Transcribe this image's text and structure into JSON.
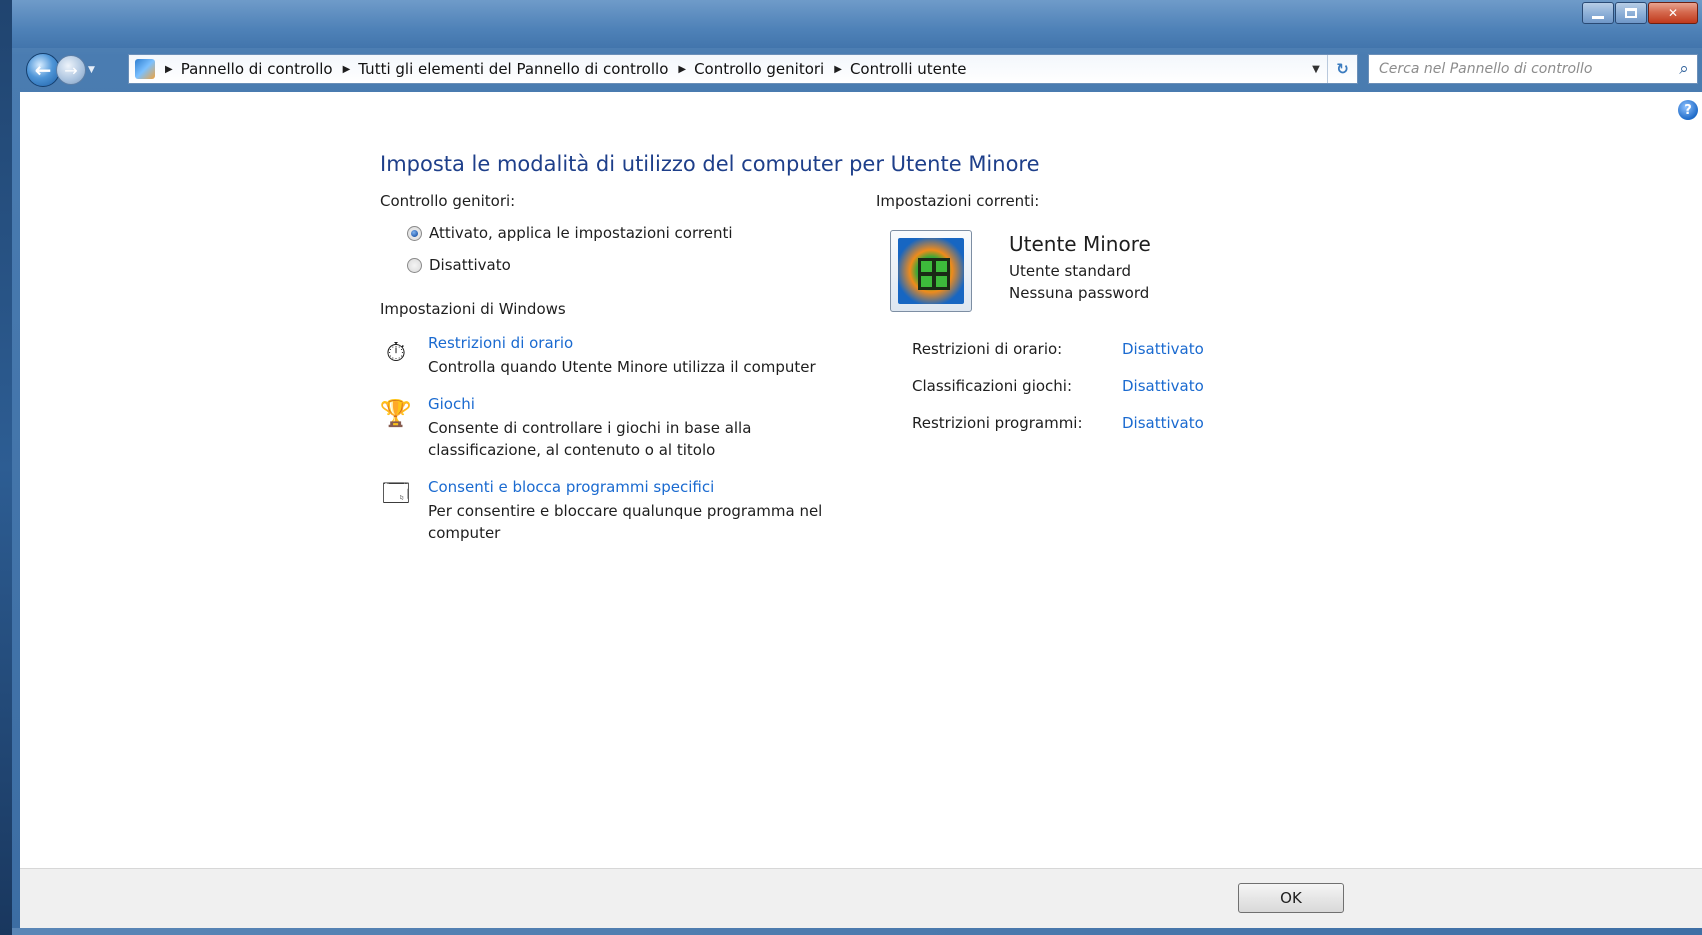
{
  "breadcrumb": {
    "items": [
      "Pannello di controllo",
      "Tutti gli elementi del Pannello di controllo",
      "Controllo genitori",
      "Controlli utente"
    ]
  },
  "search": {
    "placeholder": "Cerca nel Pannello di controllo"
  },
  "main": {
    "title": "Imposta le modalità di utilizzo del computer per Utente Minore",
    "parental_control_label": "Controllo genitori:",
    "radio_on": "Attivato, applica le impostazioni correnti",
    "radio_off": "Disattivato",
    "radio_selected": "on",
    "windows_settings_label": "Impostazioni di Windows",
    "tasks": [
      {
        "link": "Restrizioni di orario",
        "desc": "Controlla quando Utente Minore utilizza il computer",
        "icon": "stopwatch-icon"
      },
      {
        "link": "Giochi",
        "desc": "Consente di controllare i giochi in base alla classificazione, al contenuto o al titolo",
        "icon": "games-trophy-icon"
      },
      {
        "link": "Consenti e blocca programmi specifici",
        "desc": "Per consentire e bloccare qualunque programma nel computer",
        "icon": "programs-icon"
      }
    ]
  },
  "current": {
    "label": "Impostazioni correnti:",
    "user_name": "Utente Minore",
    "account_type": "Utente standard",
    "password_status": "Nessuna password",
    "rows": [
      {
        "label": "Restrizioni di orario:",
        "value": "Disattivato"
      },
      {
        "label": "Classificazioni giochi:",
        "value": "Disattivato"
      },
      {
        "label": "Restrizioni programmi:",
        "value": "Disattivato"
      }
    ]
  },
  "footer": {
    "ok_label": "OK"
  },
  "colors": {
    "title": "#1e3f8a",
    "link": "#1a6ad0",
    "chrome": "#4a7cb1"
  }
}
